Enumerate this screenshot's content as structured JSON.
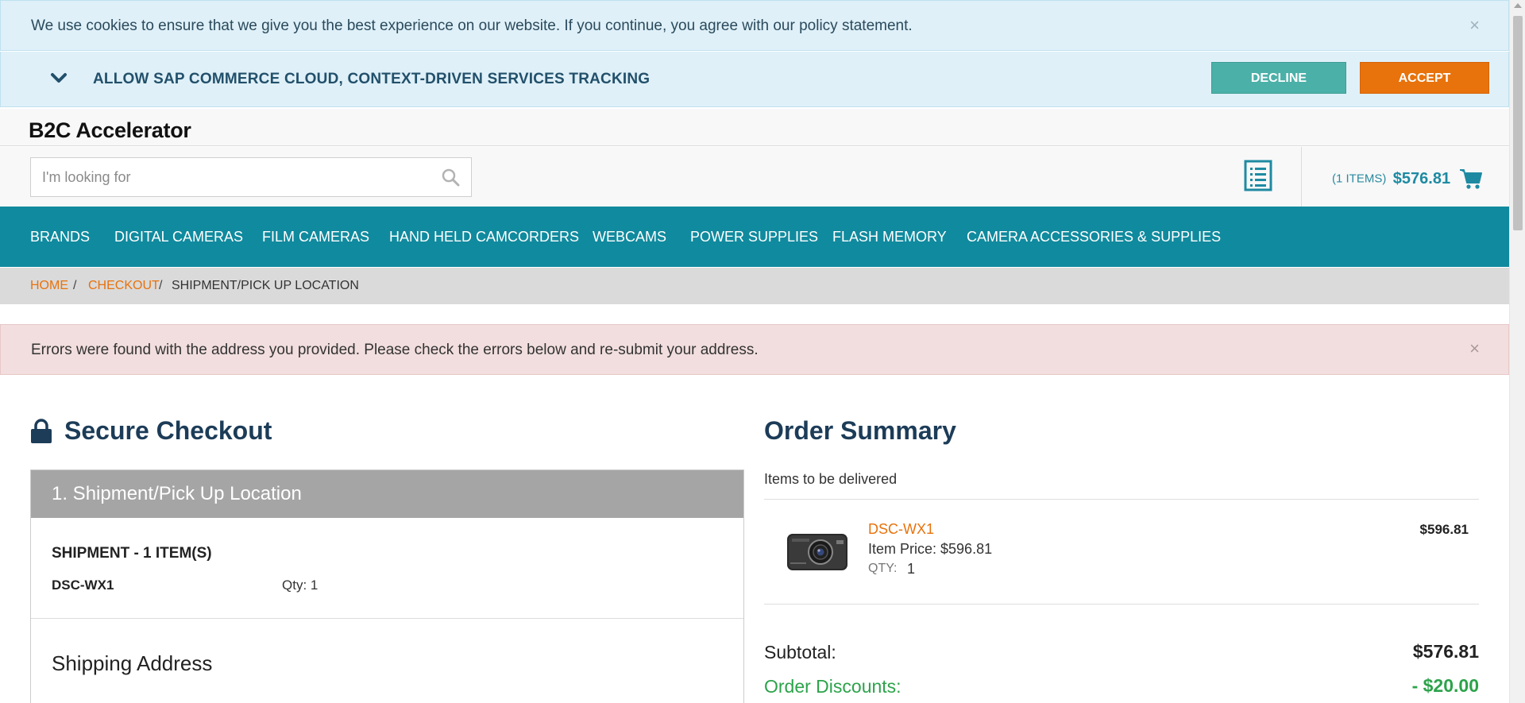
{
  "cookie_notice": {
    "text": "We use cookies to ensure that we give you the best experience on our website. If you continue, you agree with our policy statement.",
    "close_label": "×"
  },
  "tracking": {
    "label": "ALLOW SAP COMMERCE CLOUD, CONTEXT-DRIVEN SERVICES TRACKING",
    "decline_label": "DECLINE",
    "accept_label": "ACCEPT"
  },
  "header": {
    "logo": "B2C Accelerator",
    "search_placeholder": "I'm looking for",
    "cart_count": "(1 ITEMS)",
    "cart_total": "$576.81"
  },
  "nav": {
    "items": [
      "BRANDS",
      "DIGITAL CAMERAS",
      "FILM CAMERAS",
      "HAND HELD CAMCORDERS",
      "WEBCAMS",
      "POWER SUPPLIES",
      "FLASH MEMORY",
      "CAMERA ACCESSORIES & SUPPLIES"
    ]
  },
  "breadcrumb": {
    "home": "HOME",
    "checkout": "CHECKOUT",
    "current": "SHIPMENT/PICK UP LOCATION",
    "separator": "/"
  },
  "error": {
    "text": "Errors were found with the address you provided. Please check the errors below and re-submit your address.",
    "close_label": "×"
  },
  "checkout": {
    "title": "Secure Checkout",
    "step_title": "1. Shipment/Pick Up Location",
    "shipment_title": "SHIPMENT - 1 ITEM(S)",
    "product_code": "DSC-WX1",
    "qty_text": "Qty: 1",
    "shipping_address_title": "Shipping Address"
  },
  "summary": {
    "title": "Order Summary",
    "subtitle": "Items to be delivered",
    "item": {
      "name": "DSC-WX1",
      "price_label": "Item Price:  $596.81",
      "qty_label": "QTY:",
      "qty_value": "1",
      "total": "$596.81"
    },
    "subtotal_label": "Subtotal:",
    "subtotal_value": "$576.81",
    "discount_label": "Order Discounts:",
    "discount_value": "- $20.00"
  },
  "colors": {
    "nav_bg": "#108a9e",
    "accent_orange": "#e8720c",
    "decline_teal": "#4bb0a8",
    "discount_green": "#2ca34a",
    "heading_navy": "#1c3c58"
  }
}
